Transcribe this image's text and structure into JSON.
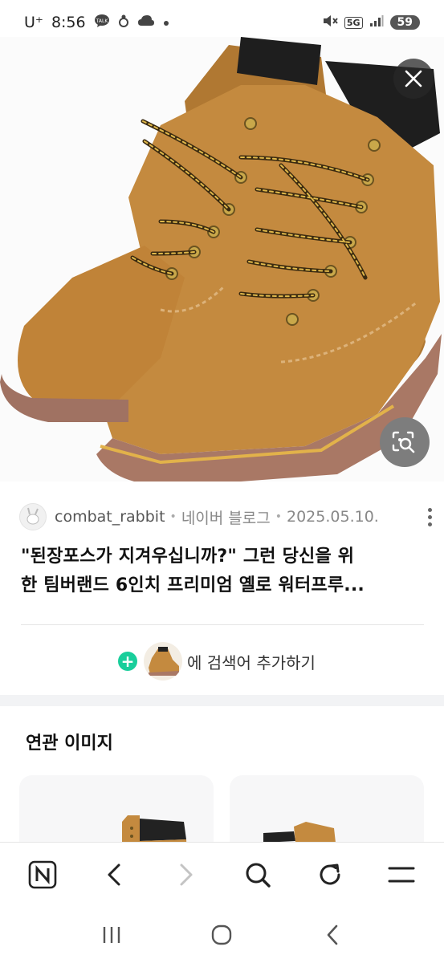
{
  "status_bar": {
    "carrier": "U⁺",
    "time": "8:56",
    "network": "5G",
    "battery": "59"
  },
  "image": {
    "close_icon": "close-icon",
    "lens_icon": "image-search-icon"
  },
  "source": {
    "author": "combat_rabbit",
    "platform": "네이버 블로그",
    "date": "2025.05.10."
  },
  "result": {
    "title_line1": "\"된장포스가 지겨우십니까?\" 그런 당신을 위",
    "title_line2": "한 팀버랜드 6인치 프리미엄 옐로 워터프루..."
  },
  "add_search": {
    "label": "에 검색어 추가하기"
  },
  "related": {
    "title": "연관 이미지"
  },
  "toolbar": {
    "items": [
      "naver-home-icon",
      "back-icon",
      "forward-icon",
      "search-icon",
      "refresh-icon",
      "menu-icon"
    ]
  },
  "navbar": {
    "items": [
      "recent-apps-icon",
      "home-icon",
      "back-icon"
    ]
  },
  "colors": {
    "accent_green": "#19ce9b",
    "boot_tan": "#c48a3f",
    "lens_gray": "#7d7d7d"
  }
}
